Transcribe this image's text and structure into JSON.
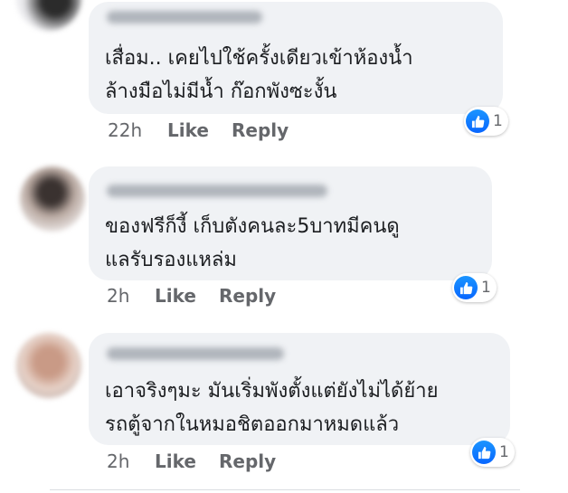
{
  "comments": [
    {
      "text": "เสื่อม.. เคยไปใช้ครั้งเดียวเข้าห้องน้ำ\nล้างมือไม่มีน้ำ  ก๊อกพังซะงั้น",
      "time": "22h",
      "like_label": "Like",
      "reply_label": "Reply",
      "reaction_count": "1"
    },
    {
      "text": "ของฟรีก็งี้ เก็บตังคนละ5บาทมีคนดู\nแลรับรองแหล่ม",
      "time": "2h",
      "like_label": "Like",
      "reply_label": "Reply",
      "reaction_count": "1"
    },
    {
      "text": "เอาจริงๆมะ มันเริ่มพังตั้งแต่ยังไม่ได้ย้าย\nรถตู้จากในหมอชิตออกมาหมดแล้ว",
      "time": "2h",
      "like_label": "Like",
      "reply_label": "Reply",
      "reaction_count": "1"
    }
  ],
  "colors": {
    "bubble": "#f0f2f5",
    "meta_text": "#65676b",
    "like_blue": "#0866ff"
  },
  "icons": [
    "thumbs-up-icon"
  ]
}
